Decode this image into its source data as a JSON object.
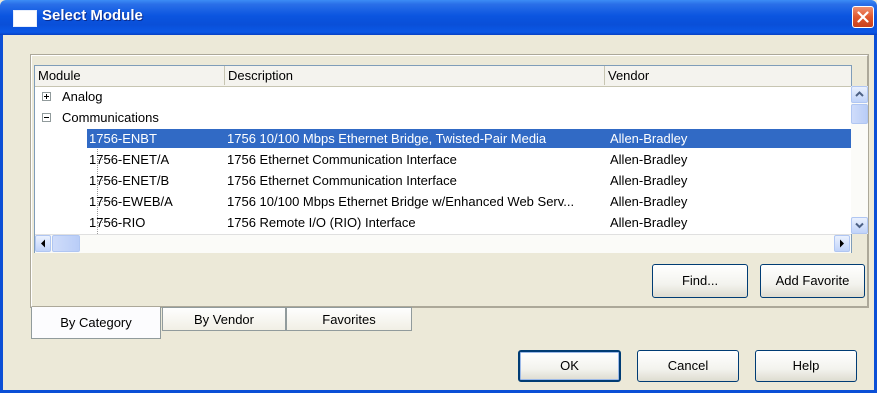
{
  "window": {
    "title": "Select Module"
  },
  "columns": [
    "Module",
    "Description",
    "Vendor"
  ],
  "rows": [
    {
      "module": "Analog",
      "description": "",
      "vendor": "",
      "level": 0,
      "expander": "plus"
    },
    {
      "module": "Communications",
      "description": "",
      "vendor": "",
      "level": 0,
      "expander": "minus"
    },
    {
      "module": "1756-ENBT",
      "description": "1756 10/100 Mbps Ethernet Bridge, Twisted-Pair Media",
      "vendor": "Allen-Bradley",
      "level": 1,
      "selected": true
    },
    {
      "module": "1756-ENET/A",
      "description": "1756 Ethernet Communication Interface",
      "vendor": "Allen-Bradley",
      "level": 1
    },
    {
      "module": "1756-ENET/B",
      "description": "1756 Ethernet Communication Interface",
      "vendor": "Allen-Bradley",
      "level": 1
    },
    {
      "module": "1756-EWEB/A",
      "description": "1756 10/100 Mbps Ethernet Bridge w/Enhanced Web Serv...",
      "vendor": "Allen-Bradley",
      "level": 1
    },
    {
      "module": "1756-RIO",
      "description": "1756 Remote I/O (RIO) Interface",
      "vendor": "Allen-Bradley",
      "level": 1
    }
  ],
  "buttons": {
    "find": "Find...",
    "add_favorite": "Add Favorite",
    "ok": "OK",
    "cancel": "Cancel",
    "help": "Help"
  },
  "tabs": [
    {
      "label": "By Category",
      "active": true
    },
    {
      "label": "By Vendor",
      "active": false
    },
    {
      "label": "Favorites",
      "active": false
    }
  ],
  "colors": {
    "titlebar": "#0b55e0",
    "selection": "#316ac5",
    "dialog_bg": "#ece9d8"
  },
  "icons": {
    "window": "window-icon",
    "close": "close-icon",
    "scroll_up": "arrow-up-icon",
    "scroll_down": "arrow-down-icon",
    "scroll_left": "arrow-left-icon",
    "scroll_right": "arrow-right-icon"
  }
}
